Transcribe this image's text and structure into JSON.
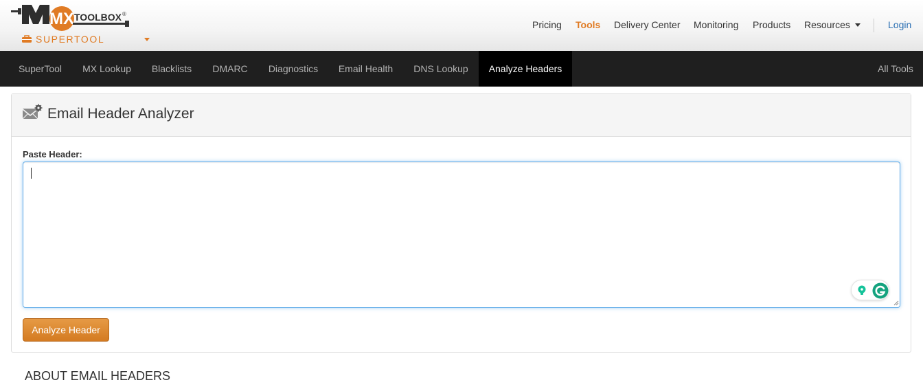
{
  "brand": {
    "logo_icon": "mxtoolbox-logo",
    "logo_text_mx": "MX",
    "logo_text_toolbox": "TOOLBOX",
    "logo_registered": "®",
    "product": "SUPERTOOL",
    "accent_color": "#e07b24"
  },
  "topnav": {
    "items": [
      {
        "label": "Pricing"
      },
      {
        "label": "Tools",
        "active": true
      },
      {
        "label": "Delivery Center"
      },
      {
        "label": "Monitoring"
      },
      {
        "label": "Products"
      },
      {
        "label": "Resources"
      }
    ],
    "login": "Login"
  },
  "tabs": {
    "items": [
      {
        "label": "SuperTool"
      },
      {
        "label": "MX Lookup"
      },
      {
        "label": "Blacklists"
      },
      {
        "label": "DMARC"
      },
      {
        "label": "Diagnostics"
      },
      {
        "label": "Email Health"
      },
      {
        "label": "DNS Lookup"
      },
      {
        "label": "Analyze Headers",
        "active": true
      }
    ],
    "all_tools": "All Tools"
  },
  "panel": {
    "icon": "mail-settings-icon",
    "title": "Email Header Analyzer",
    "field_label": "Paste Header:",
    "textarea_value": "",
    "button_label": "Analyze Header"
  },
  "about": {
    "heading": "ABOUT EMAIL HEADERS"
  },
  "colors": {
    "dark_nav": "#1f1f1f",
    "active_tab": "#000000",
    "button": "#e08a2f",
    "link": "#2a6fb3",
    "grammarly": "#15c39a"
  }
}
